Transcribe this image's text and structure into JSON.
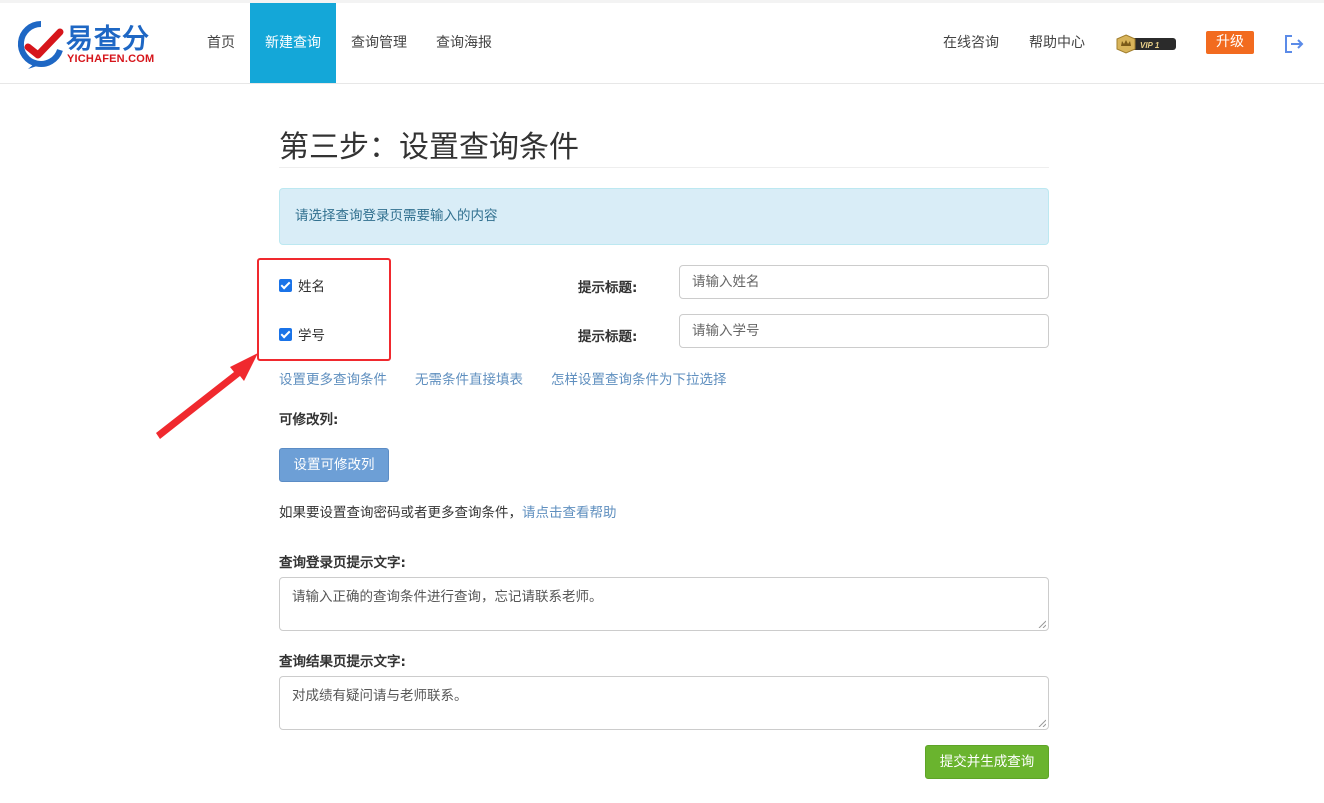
{
  "brand": {
    "name": "易查分",
    "domain": "YICHAFEN.COM",
    "primary_color": "#1e67c4",
    "accent_color": "#d6151b"
  },
  "nav": {
    "items": [
      {
        "label": "首页",
        "active": false
      },
      {
        "label": "新建查询",
        "active": true
      },
      {
        "label": "查询管理",
        "active": false
      },
      {
        "label": "查询海报",
        "active": false
      }
    ],
    "right": {
      "consult": "在线咨询",
      "help": "帮助中心",
      "vip": "VIP 1",
      "upgrade": "升级"
    },
    "active_color": "#14a7d8"
  },
  "page": {
    "title": "第三步：设置查询条件",
    "alert": "请选择查询登录页需要输入的内容"
  },
  "conditions": [
    {
      "label": "姓名",
      "checked": true,
      "hint_label": "提示标题:",
      "placeholder": "请输入姓名"
    },
    {
      "label": "学号",
      "checked": true,
      "hint_label": "提示标题:",
      "placeholder": "请输入学号"
    }
  ],
  "links": {
    "more_conditions": "设置更多查询条件",
    "no_condition": "无需条件直接填表",
    "dropdown_help": "怎样设置查询条件为下拉选择"
  },
  "editable": {
    "label": "可修改列:",
    "button": "设置可修改列"
  },
  "help": {
    "text": "如果要设置查询密码或者更多查询条件，",
    "link": "请点击查看帮助"
  },
  "login_hint": {
    "label": "查询登录页提示文字:",
    "value": "请输入正确的查询条件进行查询，忘记请联系老师。"
  },
  "result_hint": {
    "label": "查询结果页提示文字:",
    "value": "对成绩有疑问请与老师联系。"
  },
  "submit": {
    "label": "提交并生成查询",
    "color": "#6ab42e"
  },
  "annotation": {
    "color": "#f0292e"
  }
}
